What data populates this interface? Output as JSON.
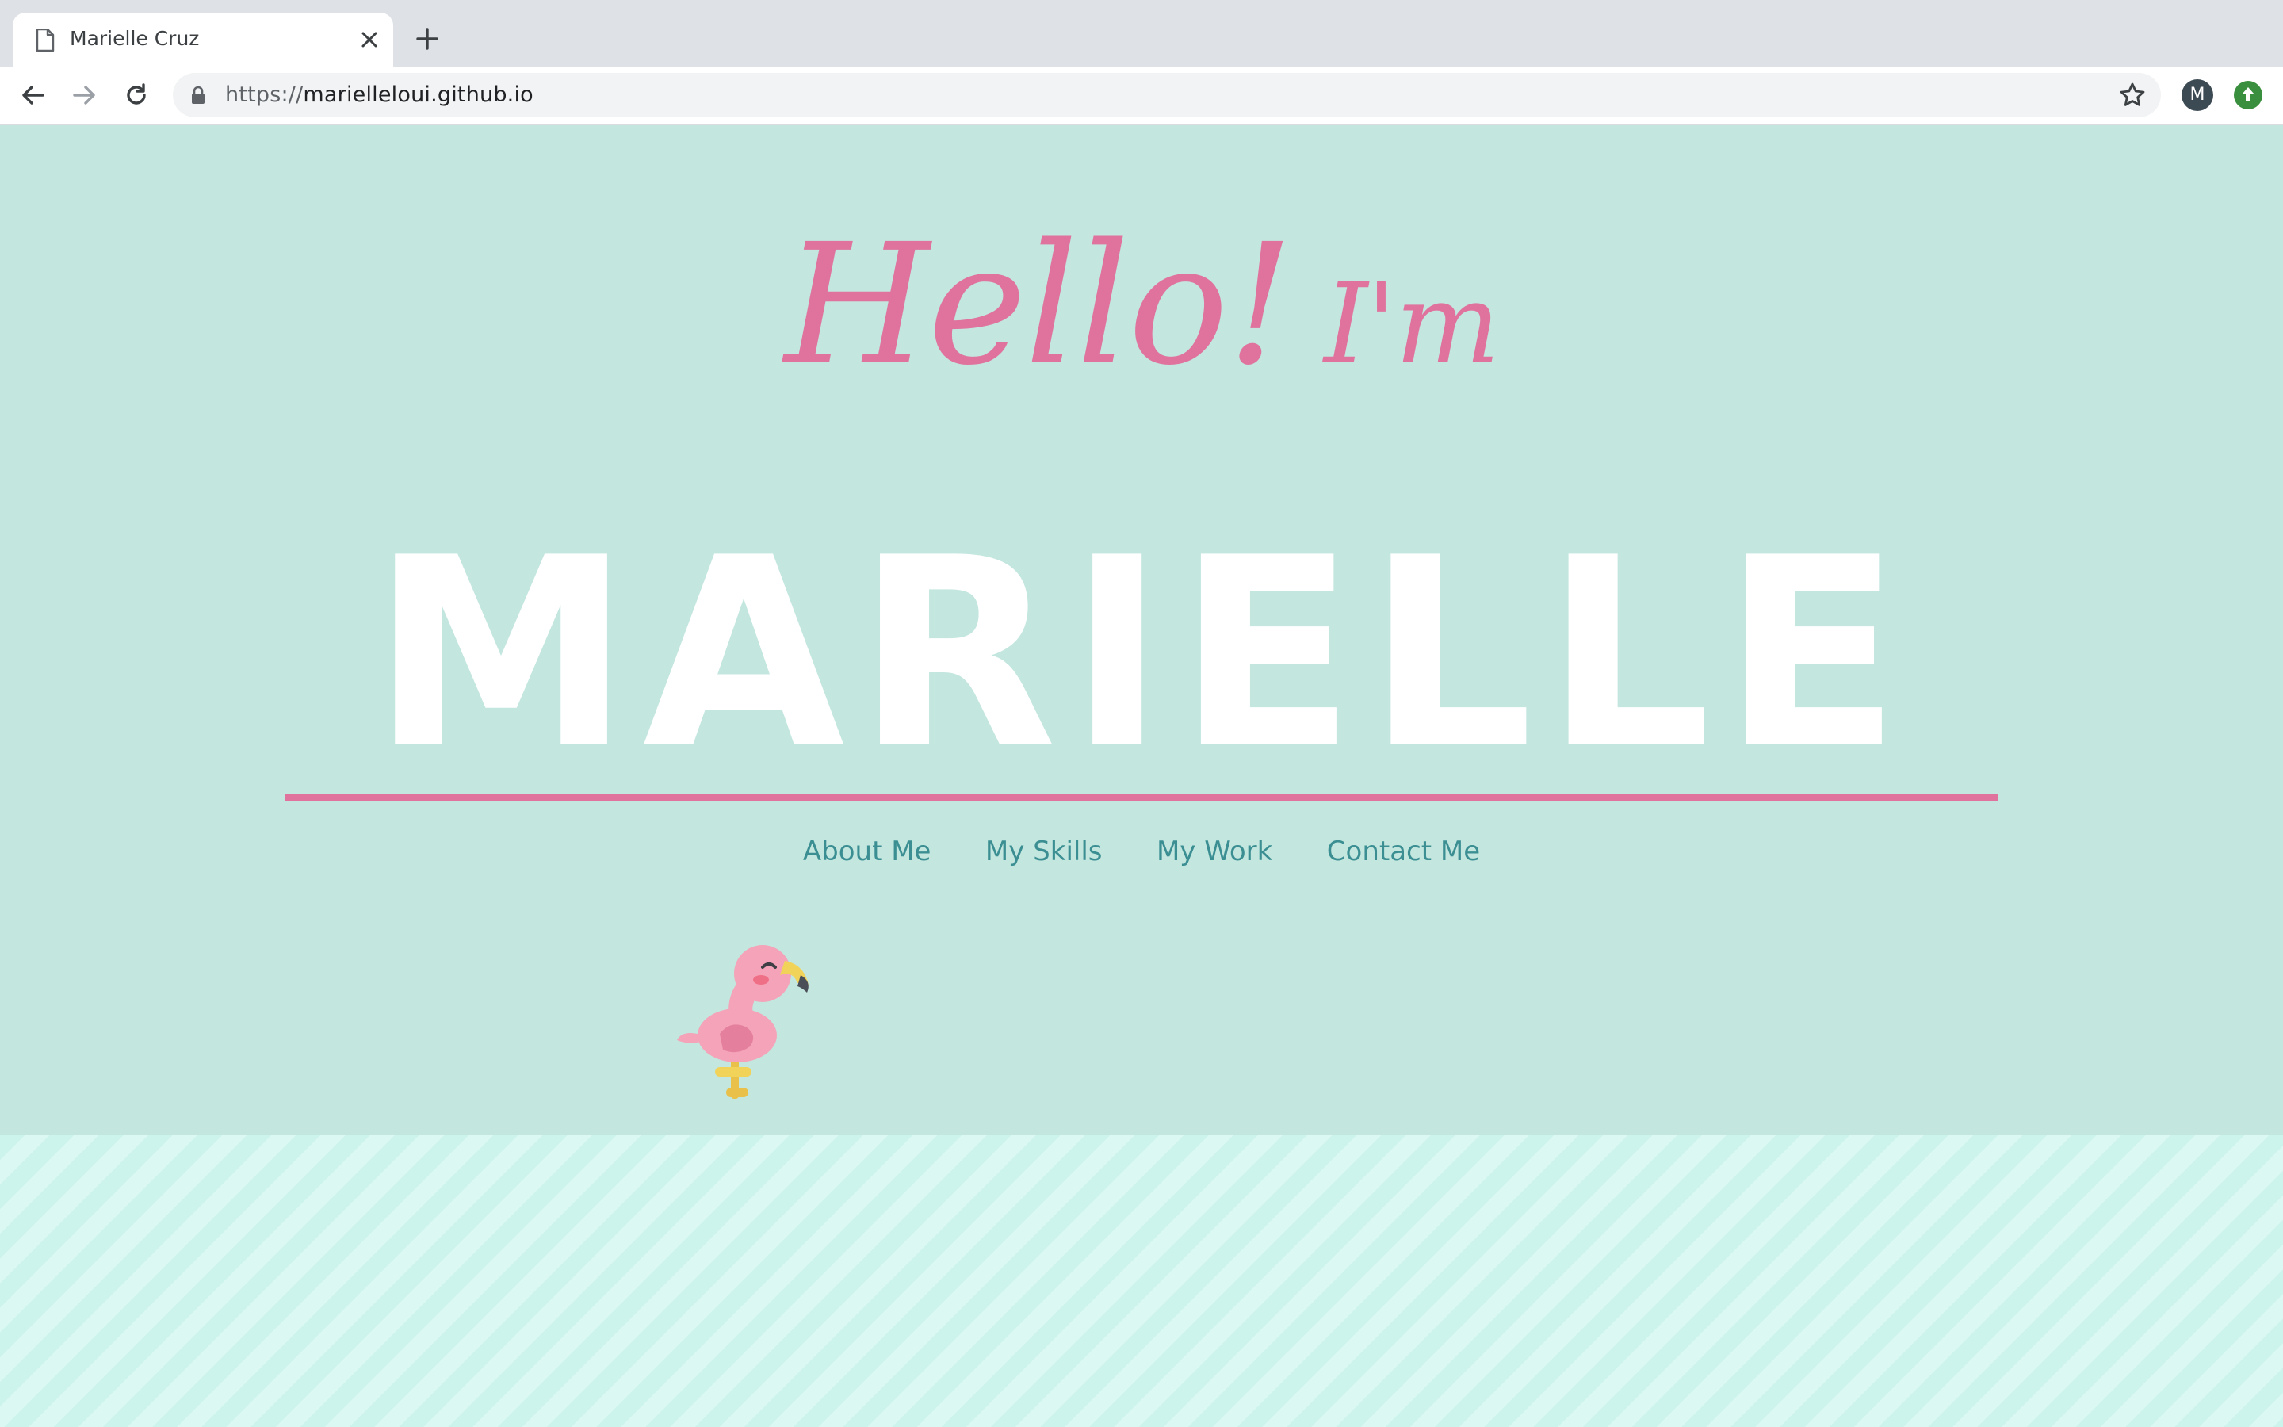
{
  "browser": {
    "tab_title": "Marielle Cruz",
    "url_scheme": "https://",
    "url_host": "marielleloui.github.io",
    "avatar_letter": "M"
  },
  "hero": {
    "greeting": "Hello!",
    "greeting_suffix": "I'm",
    "name": "MARIELLE"
  },
  "nav": {
    "items": [
      "About Me",
      "My Skills",
      "My Work",
      "Contact Me"
    ]
  },
  "colors": {
    "hero_background": "#c3e6df",
    "accent_pink": "#e0739e",
    "nav_link": "#3b8f93",
    "stripe_light": "#dcf8f2",
    "stripe_dark": "#ccf3ec"
  }
}
